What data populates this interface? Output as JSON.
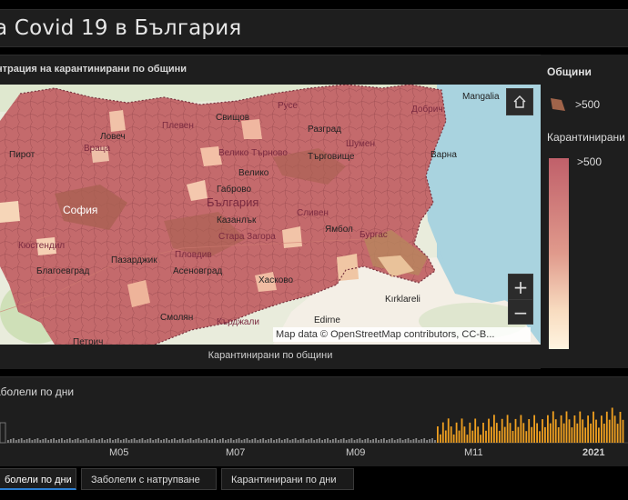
{
  "header": {
    "title": "a Covid 19 в България"
  },
  "map_panel": {
    "title": "нтрация на карантинирани по общини",
    "caption": "Карантинирани по общини",
    "attribution": "Map data © OpenStreetMap contributors, CC-B...",
    "zoom_in": "+",
    "zoom_out": "−",
    "labels": {
      "country": "България",
      "sofia": "София",
      "svishtov": "Свищов",
      "vtarnovo": "Велико Търново",
      "targovishte": "Търговище",
      "varna": "Варна",
      "pleven": "Плевен",
      "vratsa": "Враца",
      "pirot": "Пирот",
      "kazanlak": "Казанлък",
      "stara_zagora": "Стара Загора",
      "yambol": "Ямбол",
      "plovdiv": "Пловдив",
      "pazardzhik": "Пазарджик",
      "asenovgrad": "Асеновград",
      "haskovo": "Хасково",
      "smolyan": "Смолян",
      "kardzhali": "Кърджали",
      "blagoevgrad": "Благоевград",
      "kyustendil": "Кюстендил",
      "burgas": "Бургас",
      "razgrad": "Разград",
      "shumen": "Шумен",
      "dobrich": "Добрич",
      "ruse": "Русе",
      "mangalia": "Mangalia",
      "kirklareli": "Kırklareli",
      "edirne": "Edirne",
      "petrich": "Петрич",
      "sliven": "Сливен",
      "gabrovo": "Габрово",
      "veliko": "Велико",
      "lovech": "Ловеч"
    }
  },
  "legend": {
    "title": "Общини",
    "small_label": ">500",
    "subtitle": "Карантинирани",
    "ramp_label": ">500",
    "colors": {
      "high": "#c0606a",
      "low": "#fff4e0",
      "swatch": "#a0644a"
    }
  },
  "chart": {
    "title": "аболели по дни",
    "ticks": [
      "M05",
      "M07",
      "M09",
      "M11",
      "2021"
    ],
    "bar_color": "#f0a020"
  },
  "tabs": [
    {
      "label": "болели по дни",
      "active": true
    },
    {
      "label": "Заболели с натрупване",
      "active": false
    },
    {
      "label": "Карантинирани по дни",
      "active": false
    }
  ]
}
